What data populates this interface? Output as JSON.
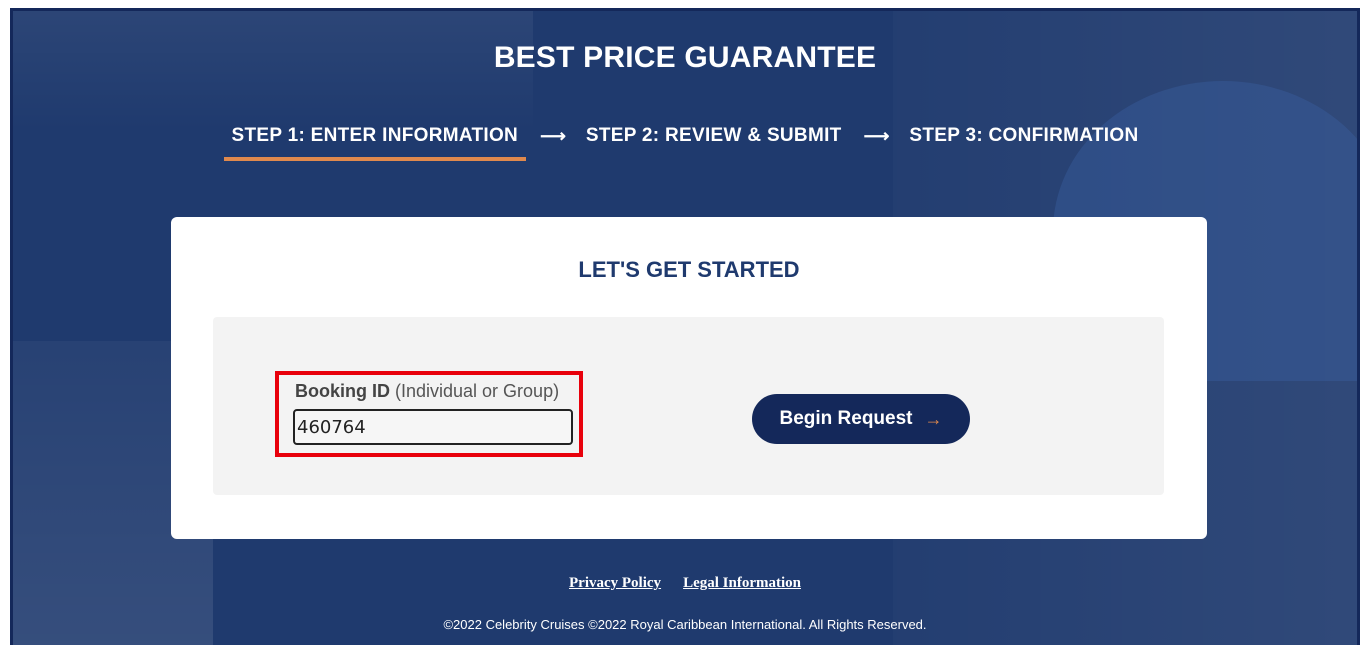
{
  "header": {
    "title": "BEST PRICE GUARANTEE"
  },
  "steps": [
    {
      "label": "STEP 1: ENTER INFORMATION",
      "active": true
    },
    {
      "label": "STEP 2: REVIEW & SUBMIT",
      "active": false
    },
    {
      "label": "STEP 3: CONFIRMATION",
      "active": false
    }
  ],
  "step_arrow": "⟶",
  "card": {
    "title": "LET'S GET STARTED",
    "booking": {
      "label_strong": "Booking ID",
      "label_note": " (Individual or Group)",
      "value": "460764"
    },
    "begin_button": {
      "label": "Begin Request",
      "arrow": "→"
    }
  },
  "footer": {
    "links": [
      {
        "label": "Privacy Policy"
      },
      {
        "label": "Legal Information"
      }
    ],
    "copyright": "©2022 Celebrity Cruises ©2022 Royal Caribbean International. All Rights Reserved."
  },
  "colors": {
    "hero_background": "#1f3a6e",
    "button_background": "#14285a",
    "accent_orange": "#e0894d",
    "highlight_red": "#e8000b"
  }
}
